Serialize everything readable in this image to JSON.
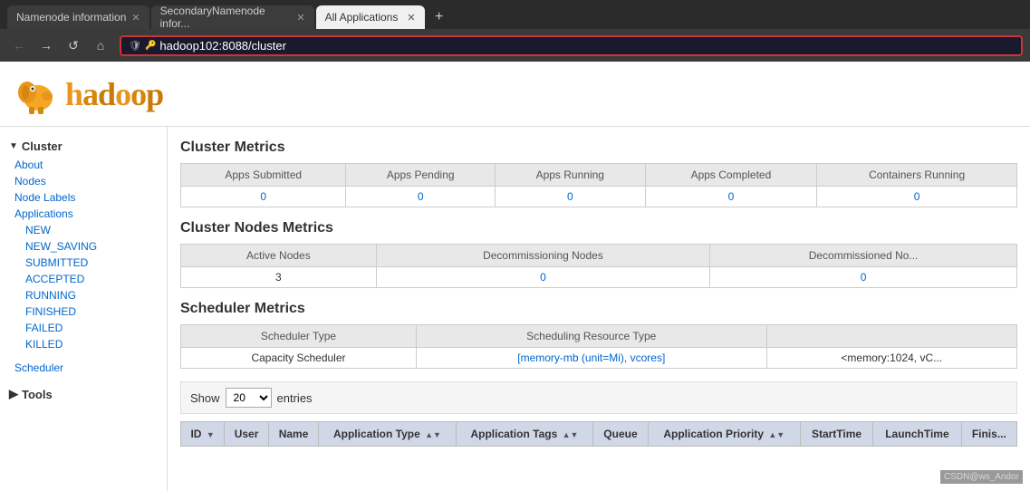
{
  "browser": {
    "tabs": [
      {
        "id": "tab1",
        "label": "Namenode information",
        "active": false
      },
      {
        "id": "tab2",
        "label": "SecondaryNamenode infor...",
        "active": false
      },
      {
        "id": "tab3",
        "label": "All Applications",
        "active": true
      }
    ],
    "new_tab_label": "+",
    "address_bar": {
      "protocol_icon": "🔒",
      "url_prefix": "hadoop102",
      "url_port": ":8088",
      "url_suffix": "/cluster"
    },
    "nav": {
      "back_label": "←",
      "forward_label": "→",
      "reload_label": "↺",
      "home_label": "⌂"
    }
  },
  "sidebar": {
    "cluster_label": "Cluster",
    "items": [
      {
        "id": "about",
        "label": "About"
      },
      {
        "id": "nodes",
        "label": "Nodes"
      },
      {
        "id": "node-labels",
        "label": "Node Labels"
      },
      {
        "id": "applications",
        "label": "Applications"
      }
    ],
    "app_subitems": [
      {
        "id": "new",
        "label": "NEW"
      },
      {
        "id": "new-saving",
        "label": "NEW_SAVING"
      },
      {
        "id": "submitted",
        "label": "SUBMITTED"
      },
      {
        "id": "accepted",
        "label": "ACCEPTED"
      },
      {
        "id": "running",
        "label": "RUNNING"
      },
      {
        "id": "finished",
        "label": "FINISHED"
      },
      {
        "id": "failed",
        "label": "FAILED"
      },
      {
        "id": "killed",
        "label": "KILLED"
      }
    ],
    "scheduler_label": "Scheduler",
    "tools_label": "Tools"
  },
  "cluster_metrics": {
    "title": "Cluster Metrics",
    "columns": [
      "Apps Submitted",
      "Apps Pending",
      "Apps Running",
      "Apps Completed",
      "Containers Running"
    ],
    "values": [
      "0",
      "0",
      "0",
      "0",
      "0"
    ]
  },
  "cluster_nodes_metrics": {
    "title": "Cluster Nodes Metrics",
    "columns": [
      "Active Nodes",
      "Decommissioning Nodes",
      "Decommissioned No..."
    ],
    "values": [
      "3",
      "0",
      "0"
    ]
  },
  "scheduler_metrics": {
    "title": "Scheduler Metrics",
    "columns": [
      "Scheduler Type",
      "Scheduling Resource Type"
    ],
    "values": [
      "Capacity Scheduler",
      "[memory-mb (unit=Mi), vcores]"
    ],
    "extra": "<memory:1024, vC..."
  },
  "applications_table": {
    "show_label": "Show",
    "show_value": "20",
    "entries_label": "entries",
    "columns": [
      {
        "id": "id",
        "label": "ID",
        "sortable": true
      },
      {
        "id": "user",
        "label": "User",
        "sortable": false
      },
      {
        "id": "name",
        "label": "Name",
        "sortable": false
      },
      {
        "id": "app-type",
        "label": "Application Type",
        "sortable": true
      },
      {
        "id": "app-tags",
        "label": "Application Tags",
        "sortable": true
      },
      {
        "id": "queue",
        "label": "Queue",
        "sortable": false
      },
      {
        "id": "app-priority",
        "label": "Application Priority",
        "sortable": true
      },
      {
        "id": "start-time",
        "label": "StartTime",
        "sortable": false
      },
      {
        "id": "launch-time",
        "label": "LaunchTime",
        "sortable": false
      },
      {
        "id": "finish",
        "label": "Finis...",
        "sortable": false
      }
    ]
  },
  "watermark": "CSDN@ws_Andor"
}
